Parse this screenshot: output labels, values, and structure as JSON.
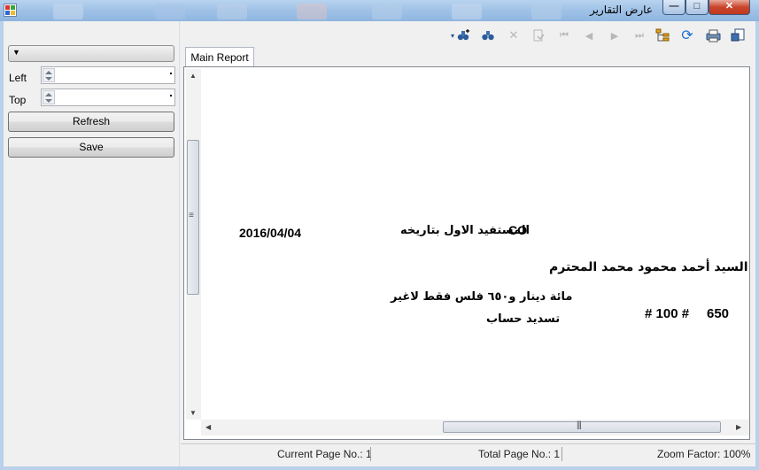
{
  "window": {
    "title": "عارض التقارير",
    "minimize_glyph": "—",
    "maximize_glyph": "□",
    "close_glyph": "✕"
  },
  "left_panel": {
    "combo_value": "",
    "left_label": "Left",
    "left_value": "",
    "top_label": "Top",
    "top_value": "",
    "refresh_label": "Refresh",
    "save_label": "Save"
  },
  "toolbar": {
    "icons": [
      "dropdown-arrow-icon",
      "find-next-icon",
      "find-icon",
      "stop-icon",
      "export-icon",
      "first-page-icon",
      "previous-page-icon",
      "next-page-icon",
      "last-page-icon",
      "document-map-icon",
      "refresh-icon",
      "print-icon",
      "page-setup-icon"
    ]
  },
  "tabs": [
    {
      "label": "Main Report"
    }
  ],
  "report": {
    "date": "2016/04/04",
    "beneficiary": "المستفيد الاول بتاريخه",
    "co": "CO",
    "recipient": "السيد أحمد محمود محمد المحترم",
    "amount_words": "مائة دينار و٦٥٠ فلس فقط لاغير",
    "purpose": "تسديد حساب",
    "amount_number": "# 100 #",
    "fils": "650"
  },
  "status_bar": {
    "current_page": "Current Page No.: 1",
    "total_pages": "Total Page No.: 1",
    "zoom": "Zoom Factor: 100%"
  },
  "colors": {
    "titlebar": "#9fc1e6",
    "window_bg": "#f0f0f0",
    "close_button": "#c9452c"
  }
}
